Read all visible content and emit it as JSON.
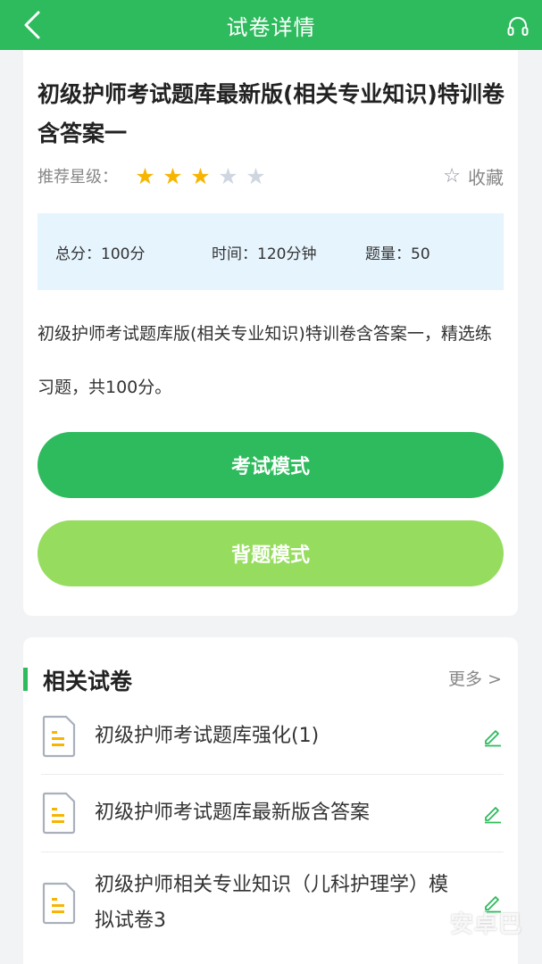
{
  "header": {
    "title": "试卷详情",
    "back_icon": "chevron-left-icon",
    "headset_icon": "headset-icon"
  },
  "paper": {
    "title": "初级护师考试题库最新版(相关专业知识)特训卷含答案一",
    "rating_label": "推荐星级：",
    "rating": 3,
    "rating_max": 5,
    "favorite_label": "收藏",
    "info": {
      "total_score": "总分：100分",
      "time": "时间：120分钟",
      "count": "题量：50"
    },
    "description": "初级护师考试题库版(相关专业知识)特训卷含答案一，精选练习题，共100分。"
  },
  "buttons": {
    "exam_mode": "考试模式",
    "recite_mode": "背题模式"
  },
  "related": {
    "title": "相关试卷",
    "more": "更多 >",
    "items": [
      {
        "label": "初级护师考试题库强化(1)"
      },
      {
        "label": "初级护师考试题库最新版含答案"
      },
      {
        "label": "初级护师相关专业知识（儿科护理学）模拟试卷3"
      }
    ]
  },
  "watermark": "安卓巴",
  "colors": {
    "primary": "#2dbb5d",
    "secondary": "#96dd5f",
    "star_on": "#f7b500",
    "star_off": "#cfd6e0",
    "info_bg": "#e6f4fd"
  }
}
